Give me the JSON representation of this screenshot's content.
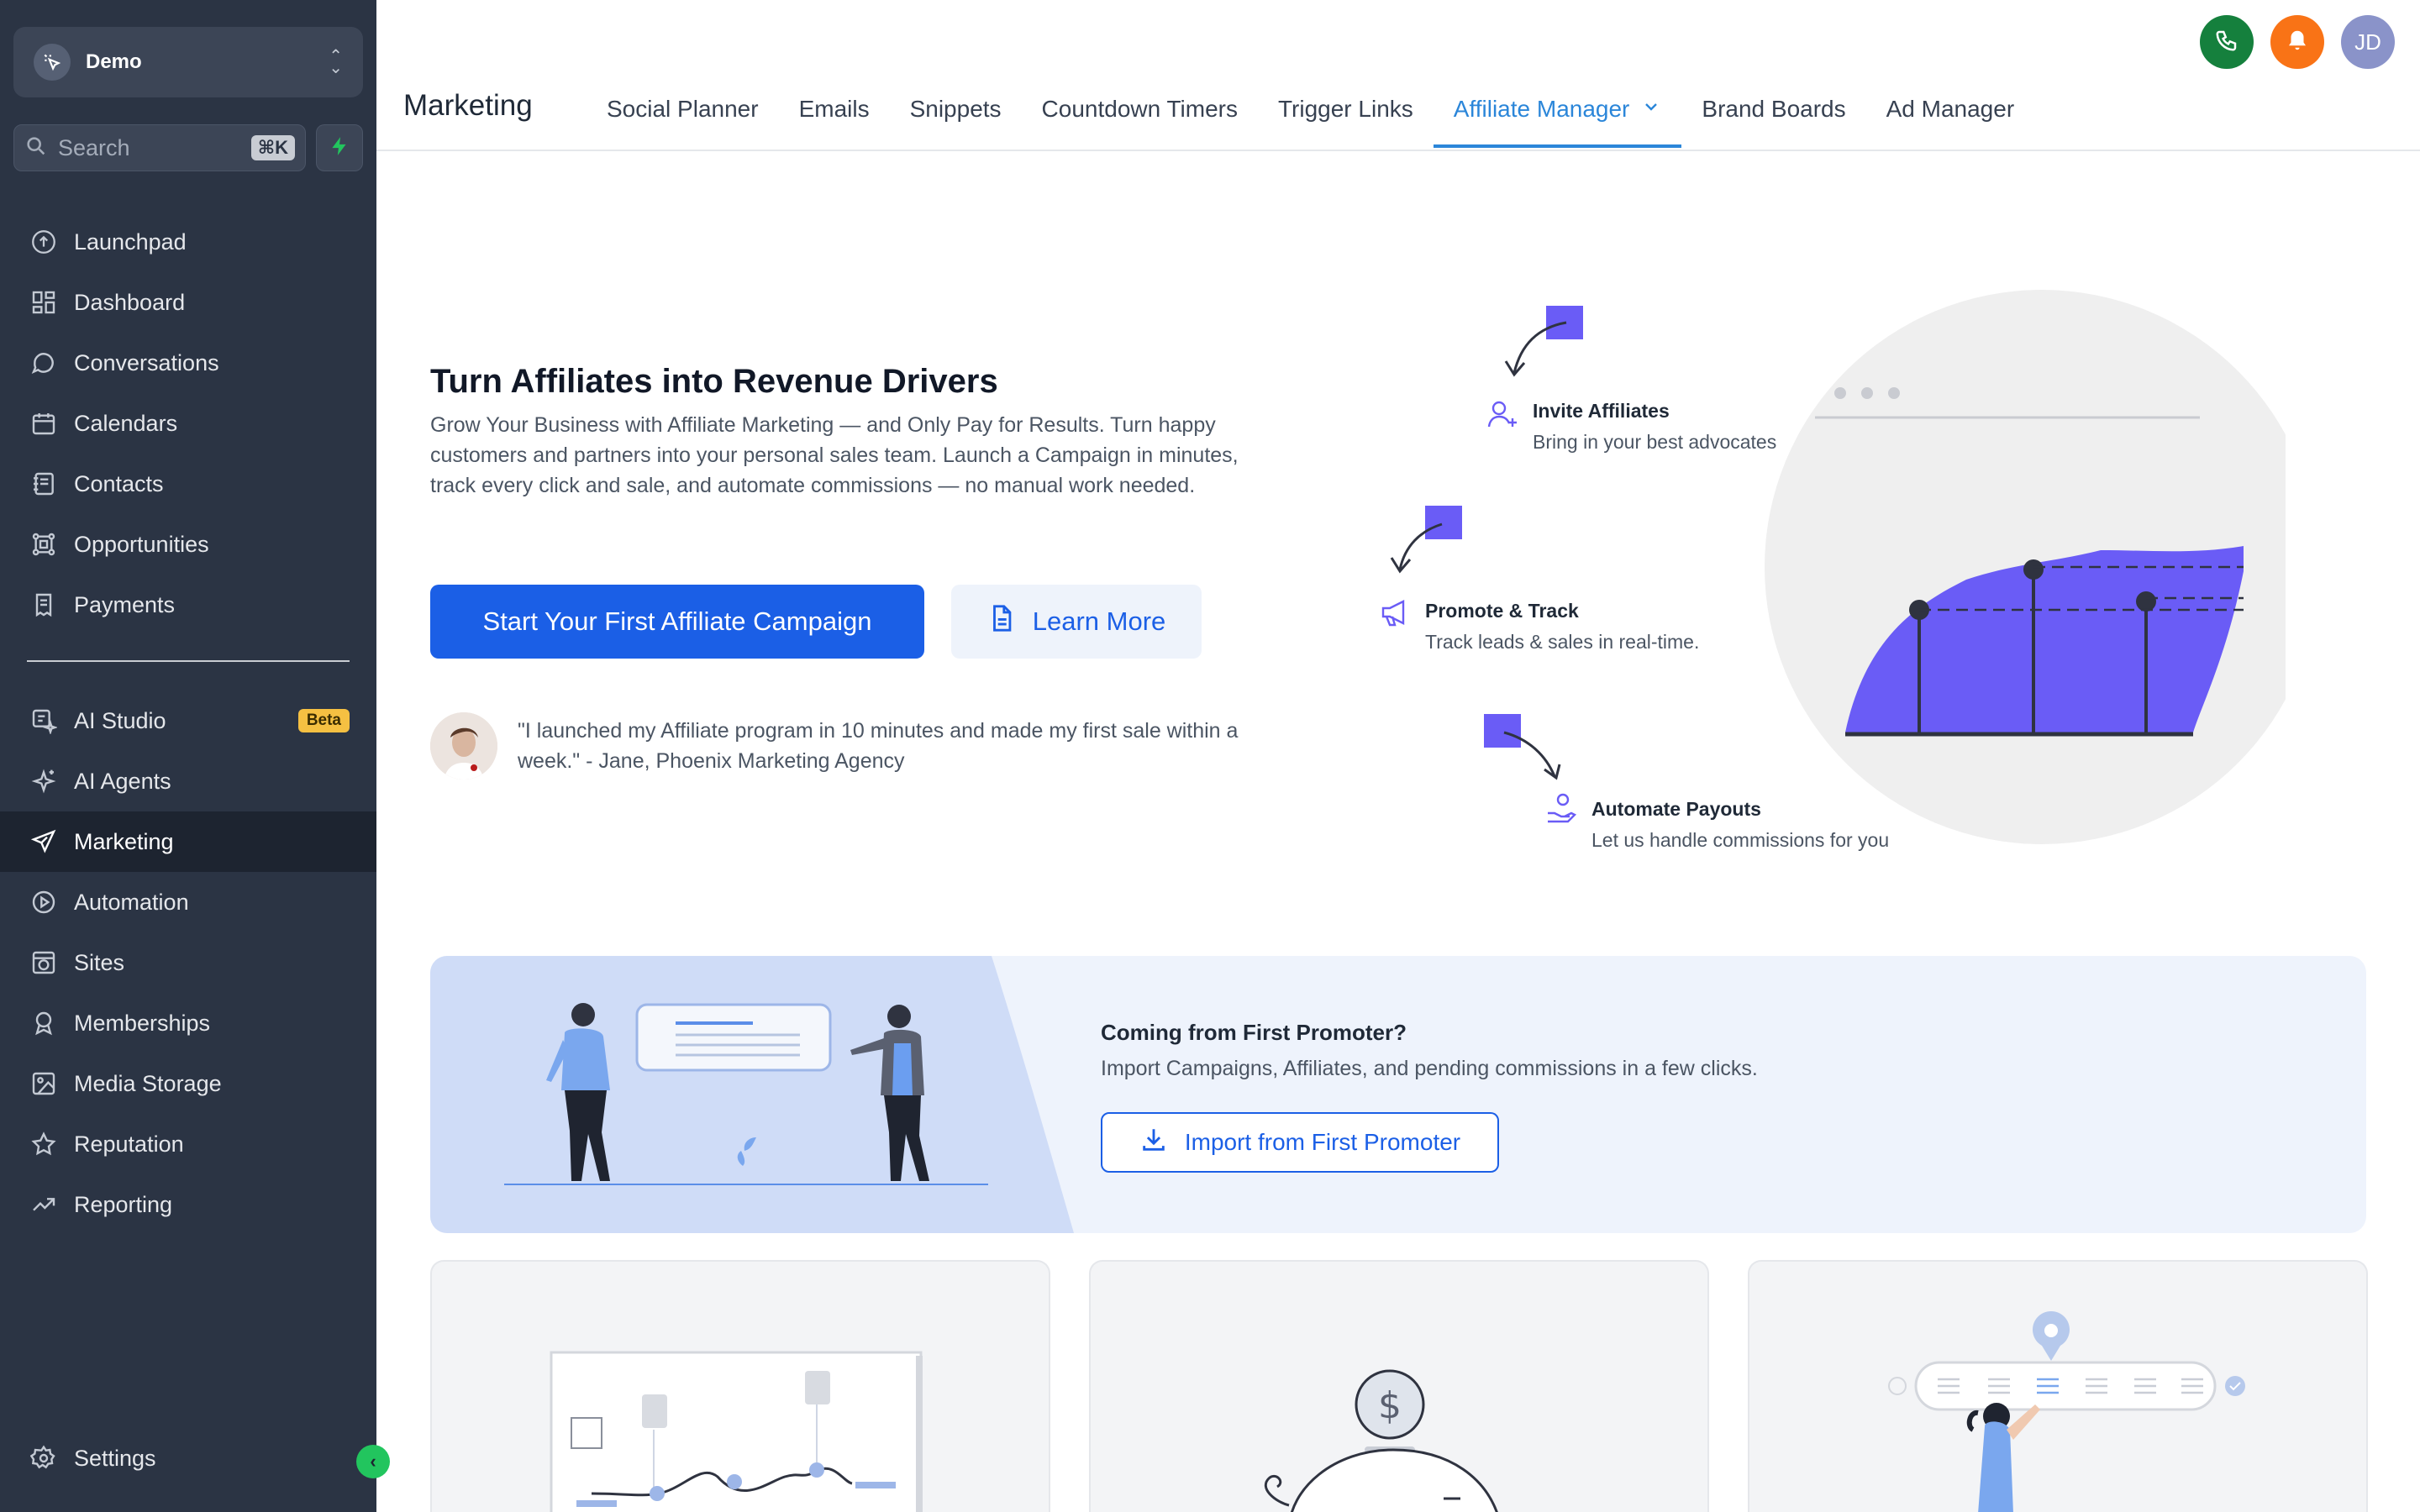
{
  "account": {
    "name": "Demo"
  },
  "search": {
    "placeholder": "Search",
    "shortcut": "⌘K"
  },
  "sidebar": {
    "items": [
      {
        "label": "Launchpad",
        "icon": "launchpad-icon"
      },
      {
        "label": "Dashboard",
        "icon": "dashboard-icon"
      },
      {
        "label": "Conversations",
        "icon": "chat-icon"
      },
      {
        "label": "Calendars",
        "icon": "calendar-icon"
      },
      {
        "label": "Contacts",
        "icon": "contacts-icon"
      },
      {
        "label": "Opportunities",
        "icon": "opportunities-icon"
      },
      {
        "label": "Payments",
        "icon": "payments-icon"
      }
    ],
    "items2": [
      {
        "label": "AI Studio",
        "icon": "ai-studio-icon",
        "badge": "Beta"
      },
      {
        "label": "AI Agents",
        "icon": "sparkle-icon"
      },
      {
        "label": "Marketing",
        "icon": "send-icon",
        "active": true
      },
      {
        "label": "Automation",
        "icon": "automation-icon"
      },
      {
        "label": "Sites",
        "icon": "sites-icon"
      },
      {
        "label": "Memberships",
        "icon": "membership-icon"
      },
      {
        "label": "Media Storage",
        "icon": "image-icon"
      },
      {
        "label": "Reputation",
        "icon": "star-icon"
      },
      {
        "label": "Reporting",
        "icon": "trend-icon"
      }
    ],
    "settings": "Settings"
  },
  "header": {
    "title": "Marketing",
    "tabs": [
      "Social Planner",
      "Emails",
      "Snippets",
      "Countdown Timers",
      "Trigger Links",
      "Affiliate Manager",
      "Brand Boards",
      "Ad Manager"
    ],
    "active_tab": "Affiliate Manager",
    "avatar_initials": "JD"
  },
  "hero": {
    "title": "Turn Affiliates into Revenue Drivers",
    "description": "Grow Your Business with Affiliate Marketing — and Only Pay for Results. Turn happy customers and partners into your personal sales team. Launch a Campaign in minutes, track every click and sale, and automate commissions — no manual work needed.",
    "primary_button": "Start Your First Affiliate Campaign",
    "secondary_button": "Learn More",
    "testimonial": "\"I launched my Affiliate program in 10 minutes and made my first sale within a week.\" - Jane, Phoenix Marketing Agency"
  },
  "steps": [
    {
      "title": "Invite Affiliates",
      "subtitle": "Bring in your best advocates"
    },
    {
      "title": "Promote & Track",
      "subtitle": "Track leads & sales in real-time."
    },
    {
      "title": "Automate Payouts",
      "subtitle": "Let us handle commissions for you"
    }
  ],
  "import_banner": {
    "title": "Coming from First Promoter?",
    "subtitle": "Import Campaigns, Affiliates, and pending commissions in a few clicks.",
    "button": "Import from First Promoter"
  },
  "colors": {
    "sidebar_bg": "#2b3444",
    "accent": "#1b5fe6",
    "active_tab": "#2b86d9",
    "illustration_purple": "#6a5cf6",
    "phone_green": "#15803d",
    "bell_orange": "#f97316"
  }
}
